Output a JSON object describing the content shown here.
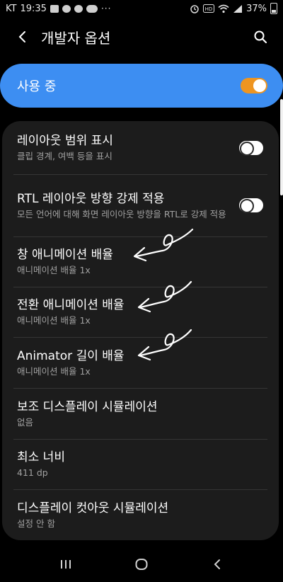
{
  "status_bar": {
    "carrier": "KT",
    "time": "19:35",
    "more": "···",
    "battery_percent": "37%",
    "icons": [
      "image-icon",
      "messenger-icon",
      "talk-icon",
      "news-icon",
      "alarm-icon",
      "hd-icon",
      "wifi-icon",
      "signal-icon",
      "battery-icon"
    ]
  },
  "header": {
    "title": "개발자 옵션",
    "back_icon": "back-arrow-icon",
    "search_icon": "search-icon"
  },
  "master_switch": {
    "label": "사용 중",
    "on": true,
    "accent": "#3d8ef2",
    "toggle_color": "#ee9521"
  },
  "settings": [
    {
      "title": "레이아웃 범위 표시",
      "subtitle": "클립 경계, 여백 등을 표시",
      "toggle": false
    },
    {
      "title": "RTL 레이아웃 방향 강제 적용",
      "subtitle": "모든 언어에 대해 화면 레이아웃 방향을 RTL로 강제 적용",
      "toggle": false
    },
    {
      "title": "창 애니메이션 배율",
      "subtitle": "애니메이션 배율 1x",
      "annotated": true
    },
    {
      "title": "전환 애니메이션 배율",
      "subtitle": "애니메이션 배율 1x",
      "annotated": true
    },
    {
      "title": "Animator 길이 배율",
      "subtitle": "애니메이션 배율 1x",
      "annotated": true
    },
    {
      "title": "보조 디스플레이 시뮬레이션",
      "subtitle": "없음"
    },
    {
      "title": "최소 너비",
      "subtitle": "411 dp"
    },
    {
      "title": "디스플레이 컷아웃 시뮬레이션",
      "subtitle": "설정 안 함"
    }
  ],
  "nav_bar": {
    "recents_icon": "recents-icon",
    "home_icon": "home-icon",
    "back_icon": "nav-back-icon"
  }
}
